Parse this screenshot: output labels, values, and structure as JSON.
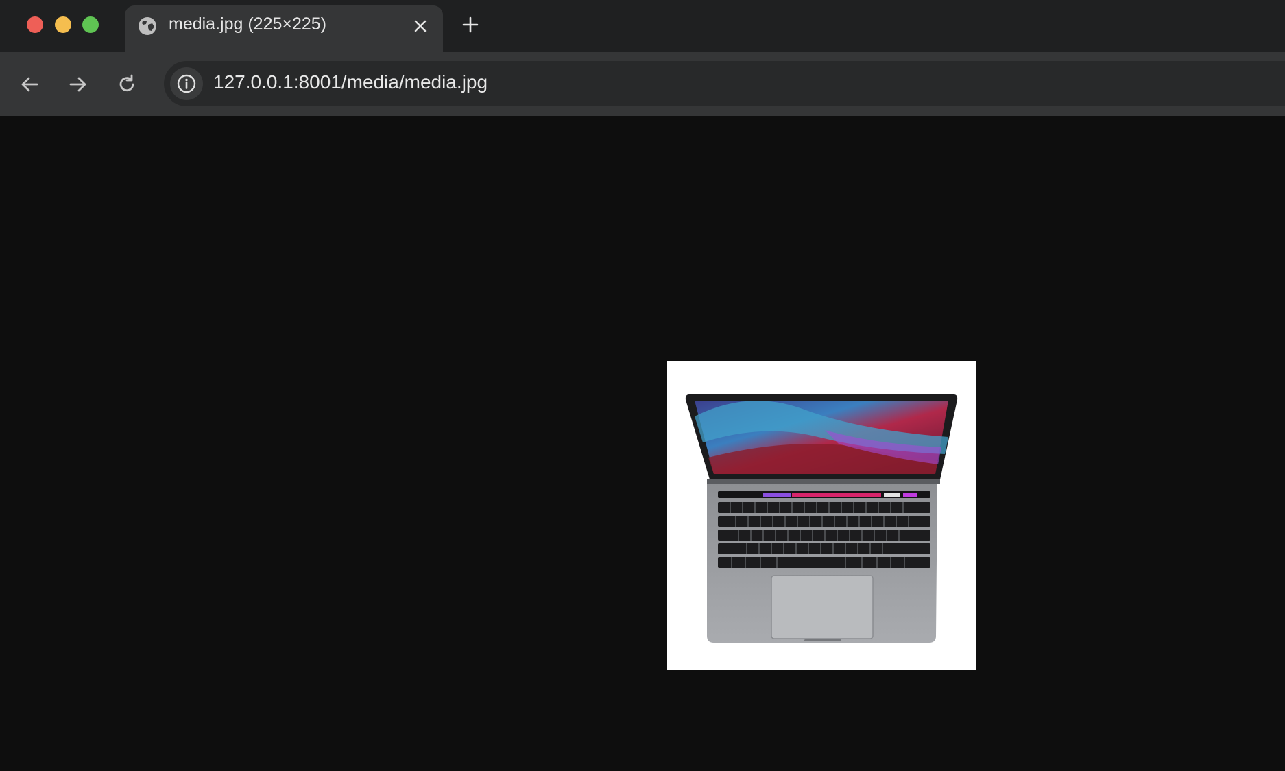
{
  "window": {
    "controls": [
      "close",
      "minimize",
      "maximize"
    ]
  },
  "tab": {
    "title": "media.jpg (225×225)",
    "icon": "globe-icon",
    "close_icon": "close-icon"
  },
  "new_tab_icon": "plus-icon",
  "toolbar": {
    "back_icon": "arrow-left-icon",
    "forward_icon": "arrow-right-icon",
    "reload_icon": "reload-icon",
    "site_info_icon": "info-icon",
    "url": "127.0.0.1:8001/media/media.jpg"
  },
  "content": {
    "image": {
      "description_icon": "laptop-image"
    }
  },
  "colors": {
    "titlebar": "#1f2021",
    "toolbar": "#353637",
    "omnibox": "#28292a",
    "page_background": "#0e0e0e",
    "close": "#ee5f57",
    "minimize": "#f5be4f",
    "maximize": "#5fc453"
  }
}
